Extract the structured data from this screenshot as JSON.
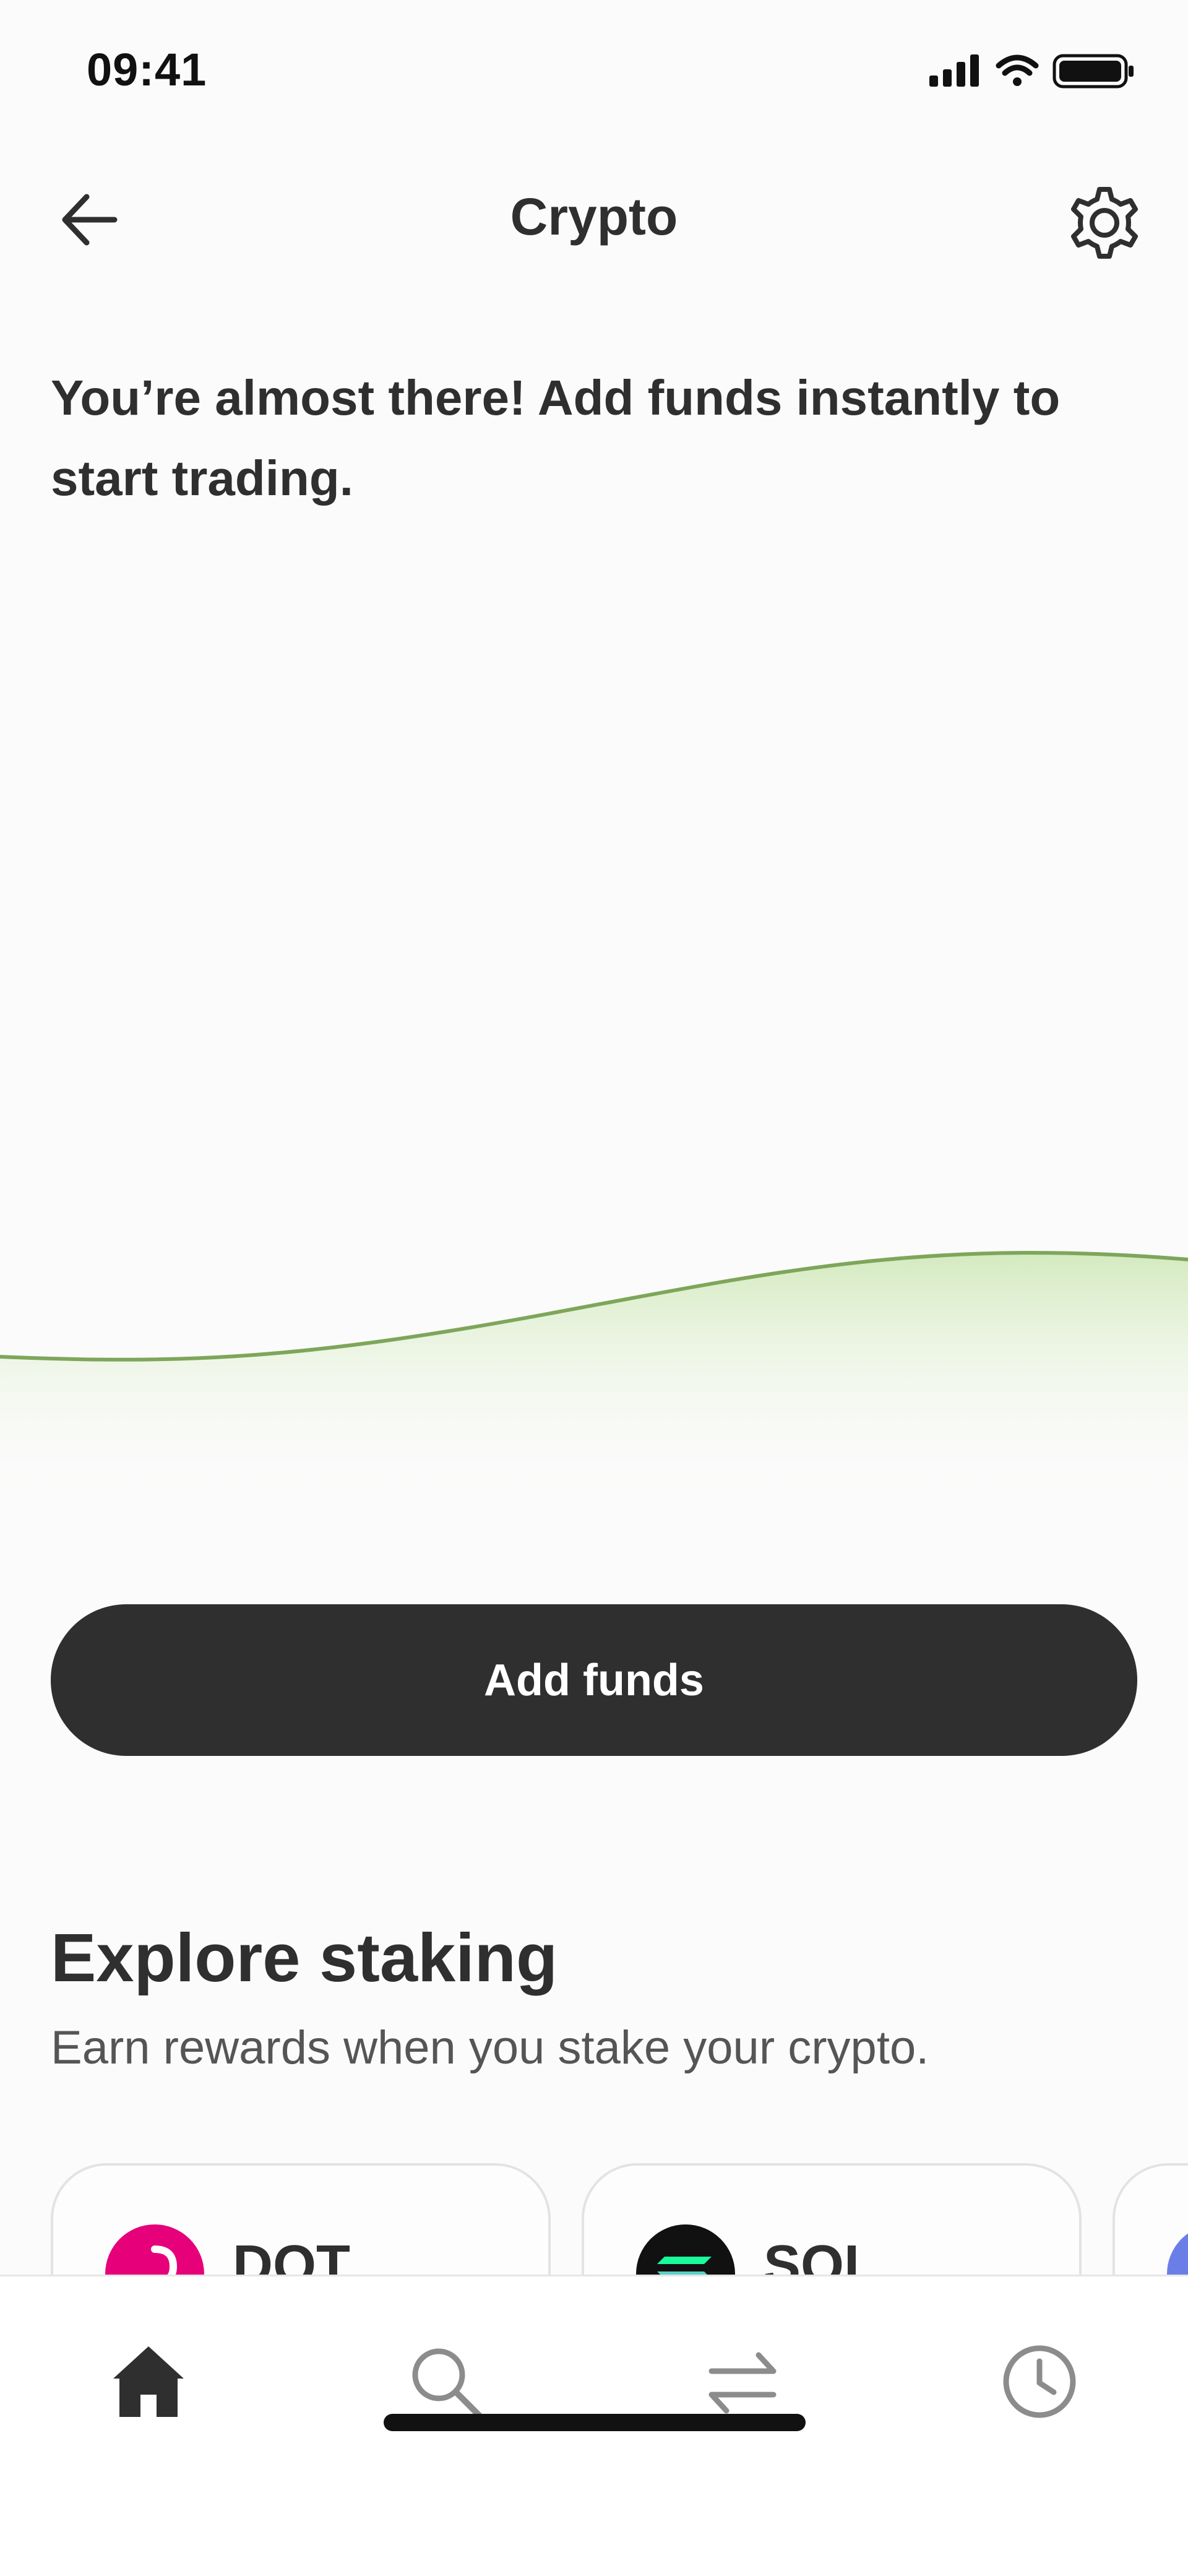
{
  "status_bar": {
    "time": "09:41",
    "icons": [
      "cellular-signal-icon",
      "wifi-icon",
      "battery-icon"
    ]
  },
  "header": {
    "title": "Crypto",
    "back_icon": "arrow-left-icon",
    "settings_icon": "gear-icon"
  },
  "intro": {
    "message": "You’re almost there! Add funds instantly to start trading."
  },
  "chart_data": {
    "type": "area",
    "title": "",
    "note": "decorative placeholder curve without axes or values",
    "line_color": "#7ea65a",
    "fill_color": "#d6ecc2"
  },
  "actions": {
    "add_funds_label": "Add funds"
  },
  "staking": {
    "heading": "Explore staking",
    "subtitle": "Earn rewards when you stake your crypto.",
    "cards": [
      {
        "symbol": "DOT",
        "logo_color": "#e6007a"
      },
      {
        "symbol": "SOL",
        "logo_color": "#111111"
      },
      {
        "symbol": "",
        "logo_color": "#6b7ee8"
      }
    ]
  },
  "tab_bar": {
    "tabs": [
      {
        "name": "home",
        "icon": "home-icon",
        "active": true
      },
      {
        "name": "search",
        "icon": "search-icon",
        "active": false
      },
      {
        "name": "transfer",
        "icon": "transfer-arrows-icon",
        "active": false
      },
      {
        "name": "history",
        "icon": "clock-icon",
        "active": false
      }
    ],
    "active_color": "#2f2f2f",
    "inactive_color": "#8c8c8c"
  },
  "colors": {
    "background": "#fbfbfb",
    "primary_button": "#2f2f2f",
    "text": "#2f2f2f"
  }
}
